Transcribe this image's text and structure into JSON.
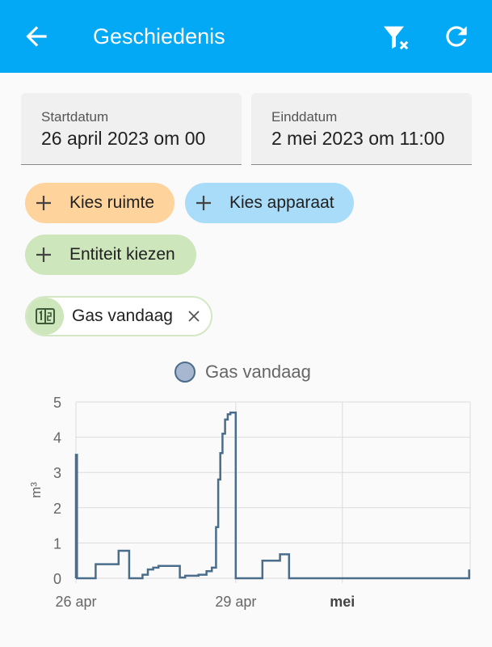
{
  "appbar": {
    "title": "Geschiedenis",
    "back_icon": "arrow-left-icon",
    "filter_icon": "filter-remove-icon",
    "refresh_icon": "refresh-icon",
    "color": "#03a9f4"
  },
  "start_date": {
    "label": "Startdatum",
    "value": "26 april 2023 om 00"
  },
  "end_date": {
    "label": "Einddatum",
    "value": "2 mei 2023 om 11:00"
  },
  "chips": {
    "room": {
      "label": "Kies ruimte",
      "color": "#ffd39c"
    },
    "device": {
      "label": "Kies apparaat",
      "color": "#a9dcf8"
    },
    "entity": {
      "label": "Entiteit kiezen",
      "color": "#cde6bc"
    }
  },
  "selected_entity": {
    "label": "Gas vandaag",
    "icon": "counter-icon",
    "remove_icon": "close-icon"
  },
  "chart_data": {
    "type": "line",
    "step": true,
    "ylabel": "m³",
    "ylim": [
      0,
      5
    ],
    "yticks": [
      0,
      1,
      2,
      3,
      4,
      5
    ],
    "xlim": [
      26.0,
      33.4
    ],
    "xticks": [
      {
        "pos": 26.0,
        "label": "26 apr",
        "bold": false
      },
      {
        "pos": 29.0,
        "label": "29 apr",
        "bold": false
      },
      {
        "pos": 31.0,
        "label": "mei",
        "bold": true
      }
    ],
    "grid": true,
    "legend_position": "top",
    "series": [
      {
        "name": "Gas vandaag",
        "color": "#4a6d8c",
        "points": [
          [
            26.0,
            3.5
          ],
          [
            26.02,
            0.0
          ],
          [
            26.37,
            0.4
          ],
          [
            26.8,
            0.78
          ],
          [
            27.0,
            0.0
          ],
          [
            27.25,
            0.1
          ],
          [
            27.35,
            0.25
          ],
          [
            27.45,
            0.3
          ],
          [
            27.55,
            0.35
          ],
          [
            27.95,
            0.02
          ],
          [
            28.05,
            0.07
          ],
          [
            28.3,
            0.1
          ],
          [
            28.45,
            0.2
          ],
          [
            28.55,
            0.3
          ],
          [
            28.63,
            1.45
          ],
          [
            28.67,
            2.8
          ],
          [
            28.71,
            3.55
          ],
          [
            28.75,
            4.1
          ],
          [
            28.8,
            4.5
          ],
          [
            28.85,
            4.65
          ],
          [
            28.9,
            4.7
          ],
          [
            29.0,
            0.0
          ],
          [
            29.5,
            0.5
          ],
          [
            29.83,
            0.68
          ],
          [
            30.0,
            0.0
          ],
          [
            33.38,
            0.25
          ]
        ]
      }
    ]
  }
}
